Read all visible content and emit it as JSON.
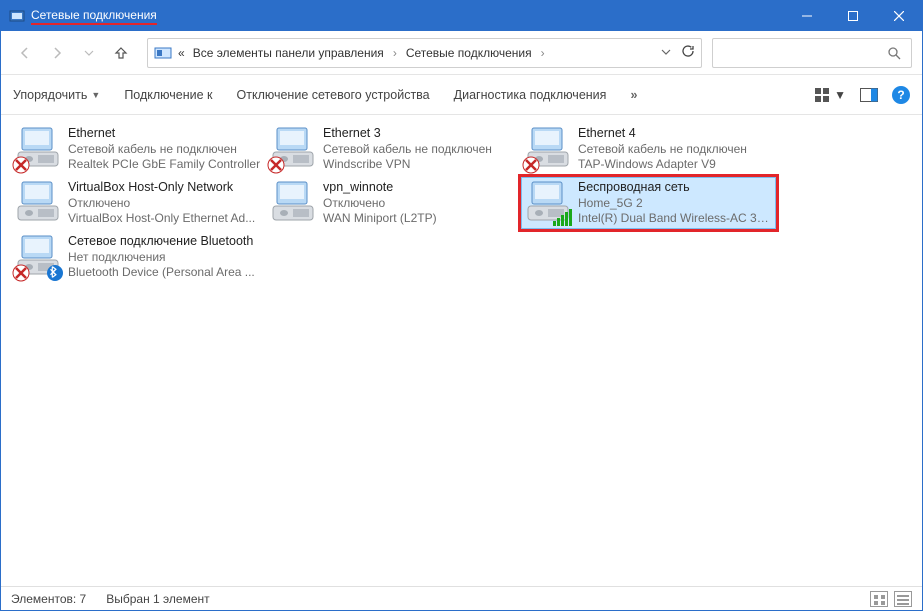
{
  "window": {
    "title": "Сетевые подключения"
  },
  "breadcrumb": {
    "prefix": "«",
    "parts": [
      "Все элементы панели управления",
      "Сетевые подключения"
    ]
  },
  "toolbar": {
    "organize": "Упорядочить",
    "connect": "Подключение к",
    "disable": "Отключение сетевого устройства",
    "diagnose": "Диагностика подключения",
    "overflow": "»"
  },
  "connections": [
    {
      "id": "ethernet",
      "name": "Ethernet",
      "line2": "Сетевой кабель не подключен",
      "line3": "Realtek PCIe GbE Family Controller",
      "overlay": "x",
      "selected": false,
      "highlighted": false
    },
    {
      "id": "ethernet3",
      "name": "Ethernet 3",
      "line2": "Сетевой кабель не подключен",
      "line3": "Windscribe VPN",
      "overlay": "x",
      "selected": false,
      "highlighted": false
    },
    {
      "id": "ethernet4",
      "name": "Ethernet 4",
      "line2": "Сетевой кабель не подключен",
      "line3": "TAP-Windows Adapter V9",
      "overlay": "x",
      "selected": false,
      "highlighted": false
    },
    {
      "id": "vbox",
      "name": "VirtualBox Host-Only Network",
      "line2": "Отключено",
      "line3": "VirtualBox Host-Only Ethernet Ad...",
      "overlay": "none",
      "selected": false,
      "highlighted": false
    },
    {
      "id": "vpn",
      "name": "vpn_winnote",
      "line2": "Отключено",
      "line3": "WAN Miniport (L2TP)",
      "overlay": "none",
      "selected": false,
      "highlighted": false
    },
    {
      "id": "wifi",
      "name": "Беспроводная сеть",
      "line2": "Home_5G 2",
      "line3": "Intel(R) Dual Band Wireless-AC 31...",
      "overlay": "wifi",
      "selected": true,
      "highlighted": true
    },
    {
      "id": "bt",
      "name": "Сетевое подключение Bluetooth",
      "line2": "Нет подключения",
      "line3": "Bluetooth Device (Personal Area ...",
      "overlay": "bt-x",
      "selected": false,
      "highlighted": false
    }
  ],
  "status": {
    "count_label": "Элементов: 7",
    "selection_label": "Выбран 1 элемент"
  }
}
